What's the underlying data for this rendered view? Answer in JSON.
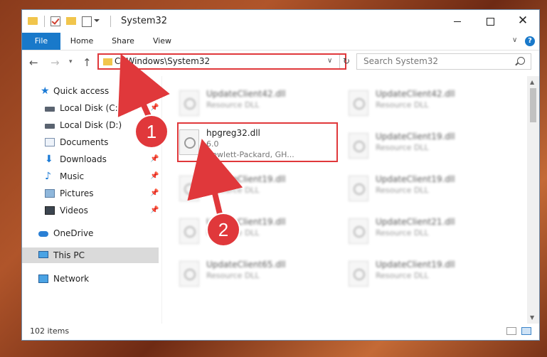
{
  "window": {
    "title": "System32"
  },
  "ribbon": {
    "tabs": [
      "File",
      "Home",
      "Share",
      "View"
    ]
  },
  "address": {
    "path": "C:\\Windows\\System32",
    "search_placeholder": "Search System32"
  },
  "nav": {
    "items": [
      {
        "label": "Quick access",
        "icon": "star-icon",
        "pinned": false
      },
      {
        "label": "Local Disk (C:)",
        "icon": "drive-icon",
        "pinned": true
      },
      {
        "label": "Local Disk (D:)",
        "icon": "drive-icon",
        "pinned": false
      },
      {
        "label": "Documents",
        "icon": "documents-icon",
        "pinned": true
      },
      {
        "label": "Downloads",
        "icon": "download-icon",
        "pinned": true
      },
      {
        "label": "Music",
        "icon": "music-icon",
        "pinned": true
      },
      {
        "label": "Pictures",
        "icon": "pictures-icon",
        "pinned": true
      },
      {
        "label": "Videos",
        "icon": "videos-icon",
        "pinned": true
      },
      {
        "label": "OneDrive",
        "icon": "cloud-icon",
        "pinned": false
      },
      {
        "label": "This PC",
        "icon": "computer-icon",
        "pinned": false,
        "selected": true
      },
      {
        "label": "Network",
        "icon": "network-icon",
        "pinned": false
      }
    ],
    "pin_glyph": "📌"
  },
  "files": [
    {
      "name": "UpdateClient42.dll",
      "line1": "Resource DLL",
      "line2": "",
      "blurred": true
    },
    {
      "name": "UpdateClient42.dll",
      "line1": "Resource DLL",
      "line2": "",
      "blurred": true
    },
    {
      "name": "hpgreg32.dll",
      "line1": "6.0",
      "line2": "Hewlett-Packard, GH...",
      "blurred": false
    },
    {
      "name": "UpdateClient19.dll",
      "line1": "Resource DLL",
      "line2": "",
      "blurred": true
    },
    {
      "name": "UpdateClient19.dll",
      "line1": "Resource DLL",
      "line2": "",
      "blurred": true
    },
    {
      "name": "UpdateClient19.dll",
      "line1": "Resource DLL",
      "line2": "",
      "blurred": true
    },
    {
      "name": "UpdateClient19.dll",
      "line1": "Resource DLL",
      "line2": "",
      "blurred": true
    },
    {
      "name": "UpdateClient21.dll",
      "line1": "Resource DLL",
      "line2": "",
      "blurred": true
    },
    {
      "name": "UpdateClient65.dll",
      "line1": "Resource DLL",
      "line2": "",
      "blurred": true
    },
    {
      "name": "UpdateClient19.dll",
      "line1": "Resource DLL",
      "line2": "",
      "blurred": true
    }
  ],
  "status": {
    "item_count": "102 items"
  },
  "annotations": {
    "step1": "1",
    "step2": "2",
    "accent_color": "#e0383b"
  }
}
